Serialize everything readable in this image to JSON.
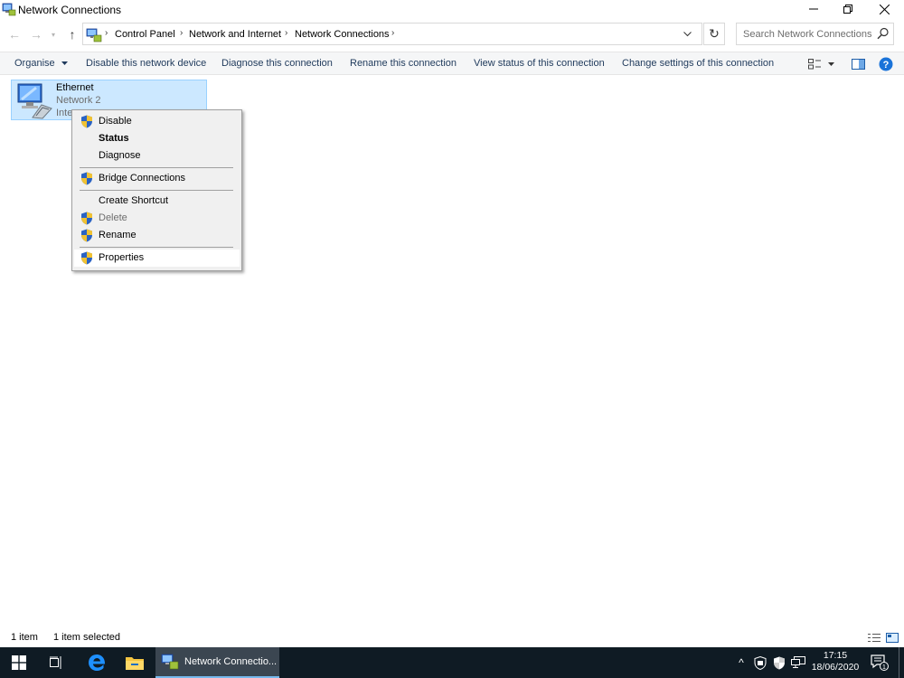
{
  "window": {
    "title": "Network Connections",
    "minimize_glyph": "—",
    "maximize_glyph": "❐",
    "close_glyph": "✕"
  },
  "nav": {
    "back_glyph": "←",
    "forward_glyph": "→",
    "recent_glyph": "▾",
    "up_glyph": "↑",
    "breadcrumbs": [
      "Control Panel",
      "Network and Internet",
      "Network Connections"
    ],
    "separator": "›",
    "refresh_glyph": "↻"
  },
  "search": {
    "placeholder": "Search Network Connections"
  },
  "commands": {
    "organise": "Organise",
    "disable": "Disable this network device",
    "diagnose": "Diagnose this connection",
    "rename": "Rename this connection",
    "view_status": "View status of this connection",
    "change_settings": "Change settings of this connection",
    "help_glyph": "?"
  },
  "item": {
    "name": "Ethernet",
    "network": "Network 2",
    "adapter_visible": "Inte"
  },
  "context_menu": {
    "items": [
      {
        "label": "Disable",
        "shield": true,
        "bold": false,
        "disabled": false
      },
      {
        "label": "Status",
        "shield": false,
        "bold": true,
        "disabled": false
      },
      {
        "label": "Diagnose",
        "shield": false,
        "bold": false,
        "disabled": false
      },
      {
        "label": "Bridge Connections",
        "shield": true,
        "bold": false,
        "disabled": false
      },
      {
        "label": "Create Shortcut",
        "shield": false,
        "bold": false,
        "disabled": false
      },
      {
        "label": "Delete",
        "shield": true,
        "bold": false,
        "disabled": true
      },
      {
        "label": "Rename",
        "shield": true,
        "bold": false,
        "disabled": false
      },
      {
        "label": "Properties",
        "shield": true,
        "bold": false,
        "disabled": false,
        "highlighted": true
      }
    ]
  },
  "status": {
    "count": "1 item",
    "selected": "1 item selected"
  },
  "taskbar": {
    "window_label": "Network Connectio...",
    "time": "17:15",
    "date": "18/06/2020",
    "notification_count": "1",
    "chevron_glyph": "^"
  },
  "colors": {
    "selection": "#cce8ff",
    "selection_border": "#99d1ff",
    "command_text": "#1e395b",
    "taskbar": "#0f1b24",
    "shield_blue": "#2a63c4",
    "shield_yellow": "#f1c232",
    "help_blue": "#1a73d9"
  }
}
